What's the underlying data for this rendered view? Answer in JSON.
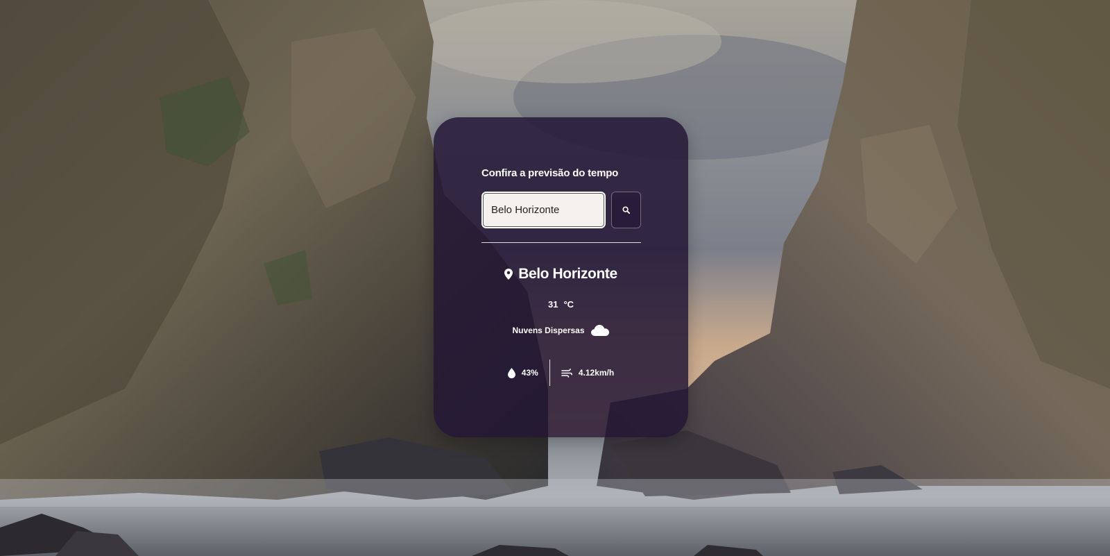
{
  "card": {
    "title": "Confira a previsão do tempo"
  },
  "search": {
    "value": "Belo Horizonte",
    "placeholder": "",
    "button_icon": "search-icon"
  },
  "weather": {
    "city": "Belo Horizonte",
    "city_icon": "location-pin-icon",
    "temperature": "31",
    "unit": "°C",
    "description": "Nuvens Dispersas",
    "description_icon": "cloud-icon",
    "humidity": "43%",
    "humidity_icon": "droplet-icon",
    "wind": "4.12km/h",
    "wind_icon": "wind-icon"
  },
  "colors": {
    "card_background": "#221634",
    "text": "#ffffff",
    "input_background": "#f4f1ee"
  }
}
